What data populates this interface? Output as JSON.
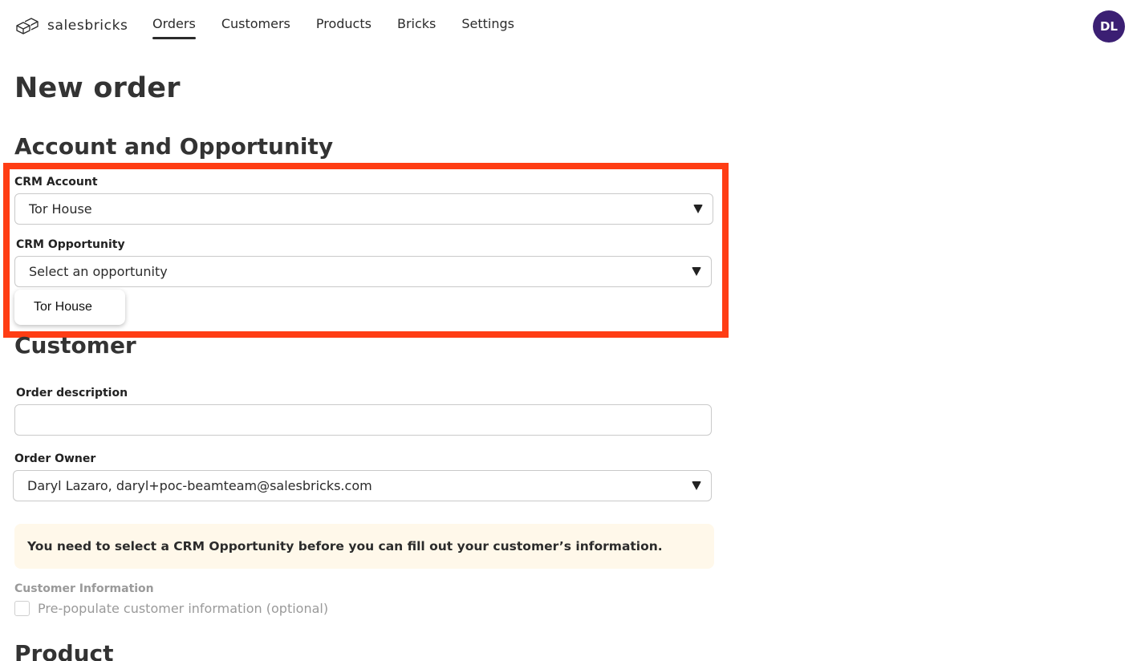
{
  "nav": {
    "logo_text": "salesbricks",
    "items": [
      {
        "label": "Orders",
        "active": true
      },
      {
        "label": "Customers",
        "active": false
      },
      {
        "label": "Products",
        "active": false
      },
      {
        "label": "Bricks",
        "active": false
      },
      {
        "label": "Settings",
        "active": false
      }
    ],
    "avatar_initials": "DL"
  },
  "page": {
    "title": "New order"
  },
  "account_section": {
    "title": "Account and Opportunity",
    "crm_account_label": "CRM Account",
    "crm_account_value": "Tor House",
    "crm_opportunity_label": "CRM Opportunity",
    "crm_opportunity_placeholder": "Select an opportunity",
    "dropdown_option": "Tor House"
  },
  "customer_section": {
    "title": "Customer",
    "order_description_label": "Order description",
    "order_description_value": "",
    "order_owner_label": "Order Owner",
    "order_owner_value": "Daryl Lazaro, daryl+poc-beamteam@salesbricks.com",
    "notice": "You need to select a CRM Opportunity before you can fill out your customer’s information.",
    "customer_info_label": "Customer Information",
    "prepopulate_label": "Pre-populate customer information (optional)"
  },
  "product_section": {
    "title": "Product"
  },
  "colors": {
    "highlight": "#ff3d14",
    "avatar_bg": "#3b1f73",
    "notice_bg": "#fff8ea"
  }
}
